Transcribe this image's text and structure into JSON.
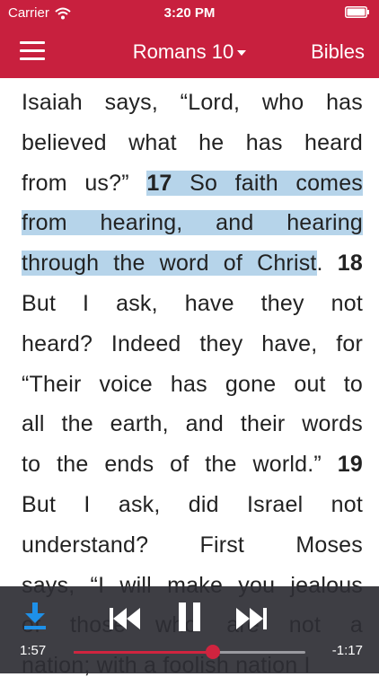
{
  "status_bar": {
    "carrier": "Carrier",
    "time": "3:20 PM",
    "battery_level": 1.0
  },
  "nav": {
    "title": "Romans 10",
    "right_button": "Bibles"
  },
  "reading": {
    "lines": [
      [
        {
          "t": "Isaiah says, “Lord, who has"
        }
      ],
      [
        {
          "t": "believed what he has heard"
        }
      ],
      [
        {
          "t": "from us?” "
        },
        {
          "t": "17",
          "b": true,
          "h": true
        },
        {
          "t": " So faith comes",
          "h": true
        }
      ],
      [
        {
          "t": "from hearing, and hearing",
          "h": true
        }
      ],
      [
        {
          "t": "through the word of Christ",
          "h": true
        },
        {
          "t": ". "
        },
        {
          "t": "18",
          "b": true
        }
      ],
      [
        {
          "t": "But I ask, have they not"
        }
      ],
      [
        {
          "t": "heard? Indeed they have, for"
        }
      ],
      [
        {
          "t": "“Their voice has gone out to"
        }
      ],
      [
        {
          "t": "all the earth, and their words"
        }
      ],
      [
        {
          "t": "to the ends of the world.” "
        },
        {
          "t": "19",
          "b": true
        }
      ],
      [
        {
          "t": "But I ask, did Israel not"
        }
      ],
      [
        {
          "t": "understand? First Moses"
        }
      ],
      [
        {
          "t": "says, “I will make you jealous"
        }
      ],
      [
        {
          "t": "of those who are not a"
        }
      ],
      [
        {
          "t": "nation; with a foolish nation I"
        }
      ]
    ]
  },
  "player": {
    "elapsed": "1:57",
    "remaining": "-1:17",
    "progress": 0.6,
    "icons": {
      "download": "download-icon",
      "previous": "skip-back-icon",
      "pause": "pause-icon",
      "next": "skip-forward-icon"
    }
  },
  "colors": {
    "brand": "#c8203e",
    "highlight": "#b6d4ea",
    "player_bg": "#2e2e34",
    "progress": "#d0243f"
  }
}
